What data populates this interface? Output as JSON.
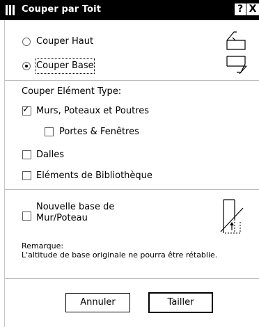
{
  "window": {
    "title": "Couper par Toit",
    "help_label": "?",
    "close_label": "X"
  },
  "options": {
    "cut_top_label": "Couper Haut",
    "cut_top_selected": false,
    "cut_base_label": "Couper Base",
    "cut_base_selected": true
  },
  "element_types": {
    "heading": "Couper Elément Type:",
    "items": [
      {
        "label": "Murs, Poteaux et Poutres",
        "checked": true
      },
      {
        "label": "Portes & Fenêtres",
        "checked": false
      },
      {
        "label": "Dalles",
        "checked": false
      },
      {
        "label": "Eléments de Bibliothèque",
        "checked": false
      }
    ]
  },
  "new_base": {
    "label_line1": "Nouvelle base de",
    "label_line2": "Mur/Poteau",
    "checked": false
  },
  "remark": {
    "title": "Remarque:",
    "text": "L'altitude de base originale ne pourra être rétablie."
  },
  "buttons": {
    "cancel_label": "Annuler",
    "ok_label": "Tailler"
  }
}
